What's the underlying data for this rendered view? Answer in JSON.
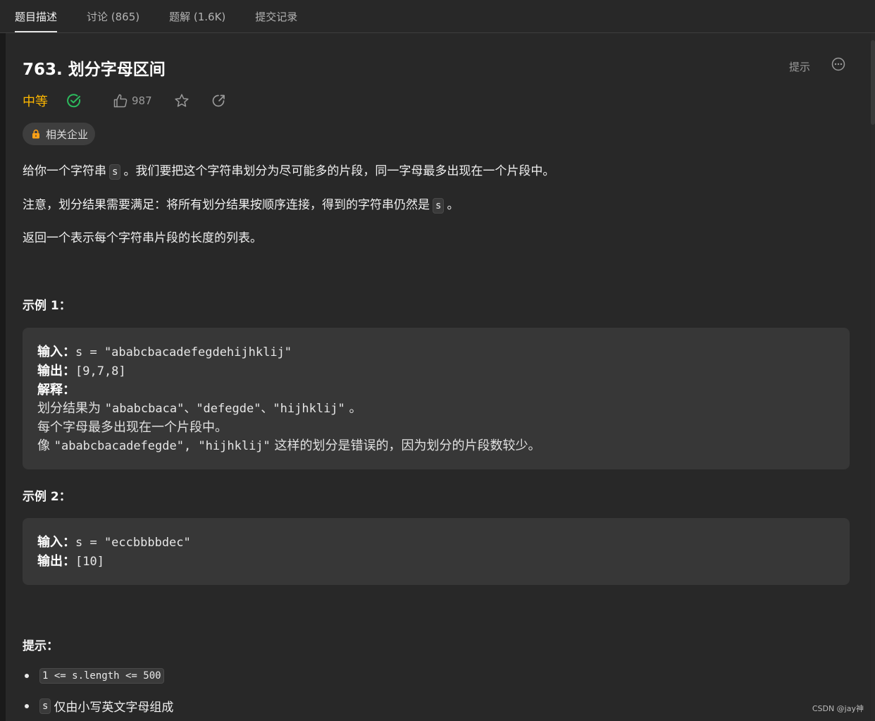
{
  "tabs": [
    {
      "label": "题目描述",
      "active": true
    },
    {
      "label": "讨论 (865)",
      "active": false
    },
    {
      "label": "题解 (1.6K)",
      "active": false
    },
    {
      "label": "提交记录",
      "active": false
    }
  ],
  "problem": {
    "title": "763. 划分字母区间",
    "hint_label": "提示",
    "difficulty": "中等",
    "difficulty_color": "#ffb800",
    "likes": "987",
    "company_tag": "相关企业"
  },
  "description": {
    "p1_before": "给你一个字符串",
    "p1_code": "s",
    "p1_after": "。我们要把这个字符串划分为尽可能多的片段，同一字母最多出现在一个片段中。",
    "p2_before": "注意，划分结果需要满足：将所有划分结果按顺序连接，得到的字符串仍然是",
    "p2_code": "s",
    "p2_after": "。",
    "p3": "返回一个表示每个字符串片段的长度的列表。"
  },
  "example1": {
    "heading": "示例 1：",
    "input_label": "输入：",
    "input_value": "s = \"ababcbacadefegdehijhklij\"",
    "output_label": "输出：",
    "output_value": "[9,7,8]",
    "explain_label": "解释：",
    "explain_line1_prefix": "划分结果为",
    "explain_line1_parts": "\"ababcbaca\"、\"defegde\"、\"hijhklij\"",
    "explain_line1_suffix": "。",
    "explain_line2": "每个字母最多出现在一个片段中。",
    "explain_line3_prefix": "像",
    "explain_line3_code": "\"ababcbacadefegde\", \"hijhklij\"",
    "explain_line3_suffix": "这样的划分是错误的，因为划分的片段数较少。"
  },
  "example2": {
    "heading": "示例 2：",
    "input_label": "输入：",
    "input_value": "s = \"eccbbbbdec\"",
    "output_label": "输出：",
    "output_value": "[10]"
  },
  "constraints": {
    "heading": "提示：",
    "item1_code": "1 <= s.length <= 500",
    "item2_code": "s",
    "item2_text": "仅由小写英文字母组成"
  },
  "watermark": "CSDN @jay神",
  "icons": [
    "check-circle-icon",
    "thumbs-up-icon",
    "star-icon",
    "share-icon",
    "more-icon",
    "lock-icon"
  ]
}
